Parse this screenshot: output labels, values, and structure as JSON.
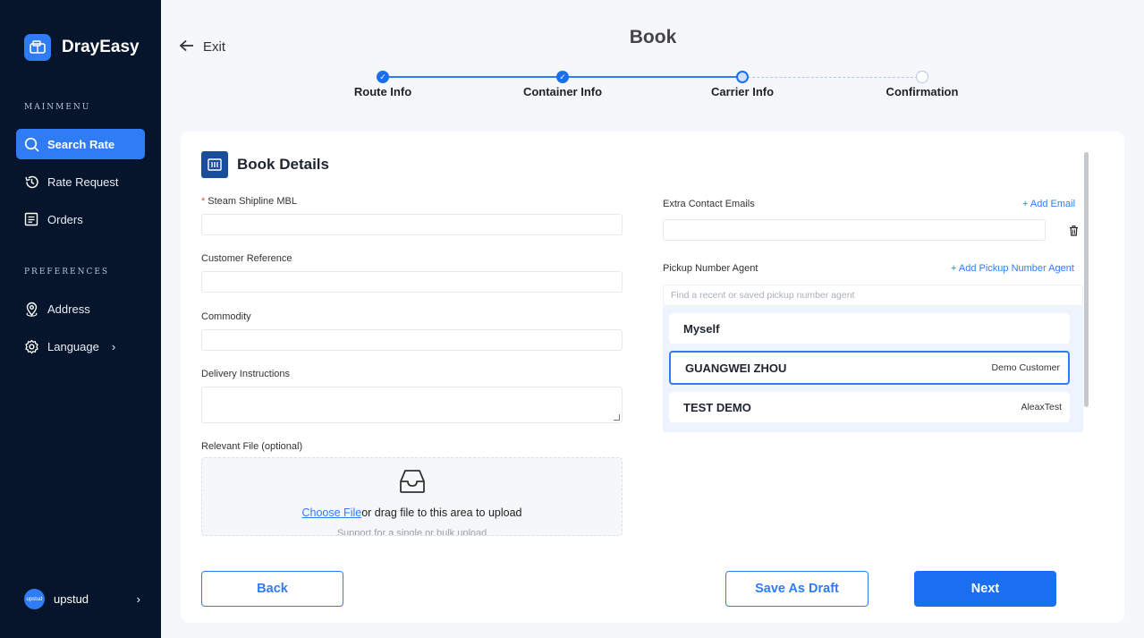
{
  "sidebar": {
    "brand": "DrayEasy",
    "main_menu_label": "MAINMENU",
    "preferences_label": "PREFERENCES",
    "items": [
      {
        "label": "Search Rate",
        "icon": "search-icon",
        "active": true
      },
      {
        "label": "Rate Request",
        "icon": "history-icon"
      },
      {
        "label": "Orders",
        "icon": "orders-icon"
      },
      {
        "label": "Address",
        "icon": "location-pin-icon"
      },
      {
        "label": "Language",
        "icon": "gear-icon"
      }
    ],
    "user": {
      "avatar_text": "upstud",
      "name": "upstud"
    }
  },
  "header": {
    "exit_label": "Exit",
    "title": "Book"
  },
  "stepper": {
    "steps": [
      {
        "label": "Route Info",
        "state": "done"
      },
      {
        "label": "Container Info",
        "state": "done"
      },
      {
        "label": "Carrier Info",
        "state": "current"
      },
      {
        "label": "Confirmation",
        "state": "todo"
      }
    ]
  },
  "form": {
    "title": "Book Details",
    "required_mark": "*",
    "steam_label": "Steam Shipline MBL",
    "steam_value": "",
    "customer_ref_label": "Customer Reference",
    "customer_ref_value": "",
    "commodity_label": "Commodity",
    "commodity_value": "",
    "delivery_label": "Delivery Instructions",
    "delivery_value": "",
    "file_label": "Relevant File (optional)",
    "file_link": "Choose File",
    "file_text": "or drag file to this area to upload",
    "file_hint": "Support for a single or bulk upload",
    "extra_emails_label": "Extra Contact Emails",
    "add_email": "+ Add Email",
    "extra_email_value": "",
    "pickup_label": "Pickup Number Agent",
    "add_pickup": "+ Add Pickup Number Agent",
    "pickup_placeholder": "Find a recent or saved pickup number agent",
    "agents": [
      {
        "name": "Myself",
        "org": ""
      },
      {
        "name": "GUANGWEI ZHOU",
        "org": "Demo Customer",
        "selected": true
      },
      {
        "name": "TEST DEMO",
        "org": "AleaxTest"
      }
    ]
  },
  "actions": {
    "back": "Back",
    "draft": "Save As Draft",
    "next": "Next"
  },
  "colors": {
    "sidebar_bg": "#06152b",
    "accent": "#2f7cf6",
    "primary_button": "#1a6ff0"
  }
}
